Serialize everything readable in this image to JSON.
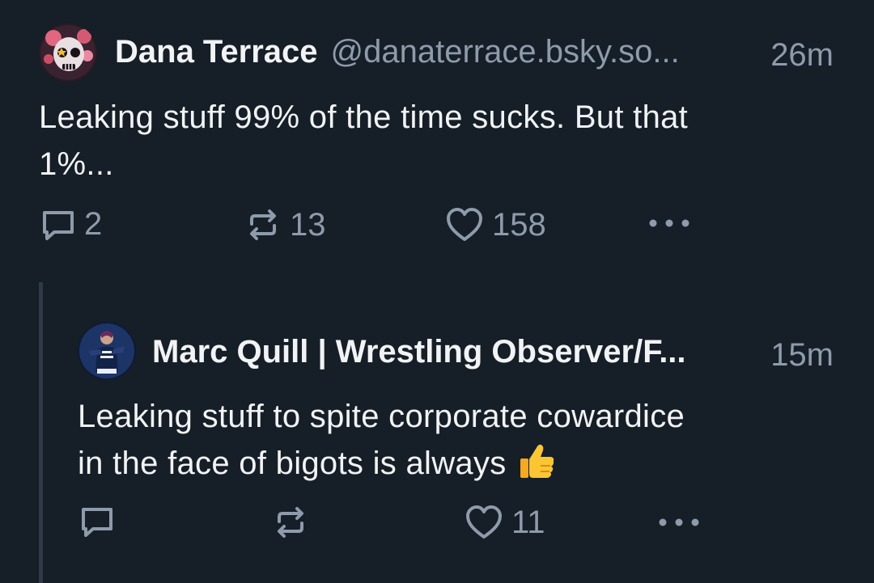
{
  "posts": [
    {
      "author": "Dana Terrace",
      "handle": "@danaterrace.bsky.so...",
      "time": "26m",
      "text_line1": "Leaking stuff 99% of the time sucks. But that",
      "text_line2": "1%...",
      "replies": "2",
      "reposts": "13",
      "likes": "158",
      "avatar_icon": "skull-avatar-icon"
    },
    {
      "author": "Marc Quill | Wrestling Observer/F...",
      "time": "15m",
      "text_line1": "Leaking stuff to spite corporate cowardice",
      "text_line2": "in the face of bigots is always",
      "emoji": "thumbs-up-emoji",
      "replies": "",
      "reposts": "",
      "likes": "11",
      "avatar_icon": "wrestler-avatar-icon"
    }
  ],
  "colors": {
    "background": "#161e27",
    "text": "#f1f3f5",
    "muted": "#8d9bab",
    "thread_line": "#2e3a47"
  }
}
